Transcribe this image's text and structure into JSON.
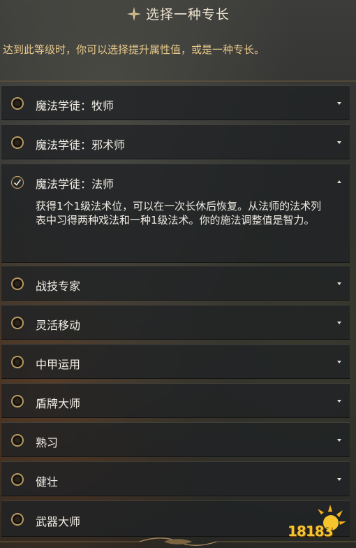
{
  "header": {
    "title": "选择一种专长",
    "icon": "star-icon"
  },
  "subtitle": "达到此等级时，你可以选择提升属性值，或是一种专长。",
  "feats": [
    {
      "label": "魔法学徒：牧师",
      "selected": false,
      "expanded": false
    },
    {
      "label": "魔法学徒：邪术师",
      "selected": false,
      "expanded": false
    },
    {
      "label": "魔法学徒：法师",
      "selected": true,
      "expanded": true,
      "description": "获得1个1级法术位，可以在一次长休后恢复。从法师的法术列表中习得两种戏法和一种1级法术。你的施法调整值是智力。"
    },
    {
      "label": "战技专家",
      "selected": false,
      "expanded": false
    },
    {
      "label": "灵活移动",
      "selected": false,
      "expanded": false
    },
    {
      "label": "中甲运用",
      "selected": false,
      "expanded": false
    },
    {
      "label": "盾牌大师",
      "selected": false,
      "expanded": false
    },
    {
      "label": "熟习",
      "selected": false,
      "expanded": false
    },
    {
      "label": "健壮",
      "selected": false,
      "expanded": false
    },
    {
      "label": "武器大师",
      "selected": false,
      "expanded": false
    }
  ],
  "watermark": {
    "text": "18183"
  },
  "colors": {
    "gold": "#b99a62",
    "subtitle": "#e8c98a",
    "panel": "#202224"
  }
}
